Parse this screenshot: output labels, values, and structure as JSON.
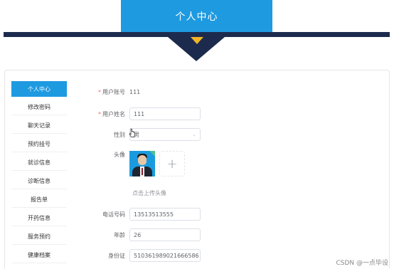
{
  "header": {
    "title": "个人中心"
  },
  "sidebar": {
    "items": [
      {
        "label": "个人中心",
        "active": true
      },
      {
        "label": "修改密码",
        "active": false
      },
      {
        "label": "聊天记录",
        "active": false
      },
      {
        "label": "预约挂号",
        "active": false
      },
      {
        "label": "就诊信息",
        "active": false
      },
      {
        "label": "诊断信息",
        "active": false
      },
      {
        "label": "报告单",
        "active": false
      },
      {
        "label": "开药信息",
        "active": false
      },
      {
        "label": "服务预约",
        "active": false
      },
      {
        "label": "健康档案",
        "active": false
      }
    ]
  },
  "form": {
    "account": {
      "label": "用户账号",
      "value": "111",
      "required": true
    },
    "name": {
      "label": "用户姓名",
      "value": "111",
      "required": true
    },
    "gender": {
      "label": "性别",
      "value": "男"
    },
    "avatar": {
      "label": "头像",
      "upload_icon": "plus-icon",
      "hint": "点击上传头像"
    },
    "phone": {
      "label": "电话号码",
      "value": "13513513555"
    },
    "age": {
      "label": "年龄",
      "value": "26"
    },
    "id_card": {
      "label": "身份证",
      "value": "510361989021666586"
    }
  },
  "watermark": "CSDN @一点毕设",
  "colors": {
    "accent": "#1e9ae0",
    "header_bar": "#1c2b4d",
    "arrow_tip": "#f0b428",
    "required": "#f56c6c"
  }
}
